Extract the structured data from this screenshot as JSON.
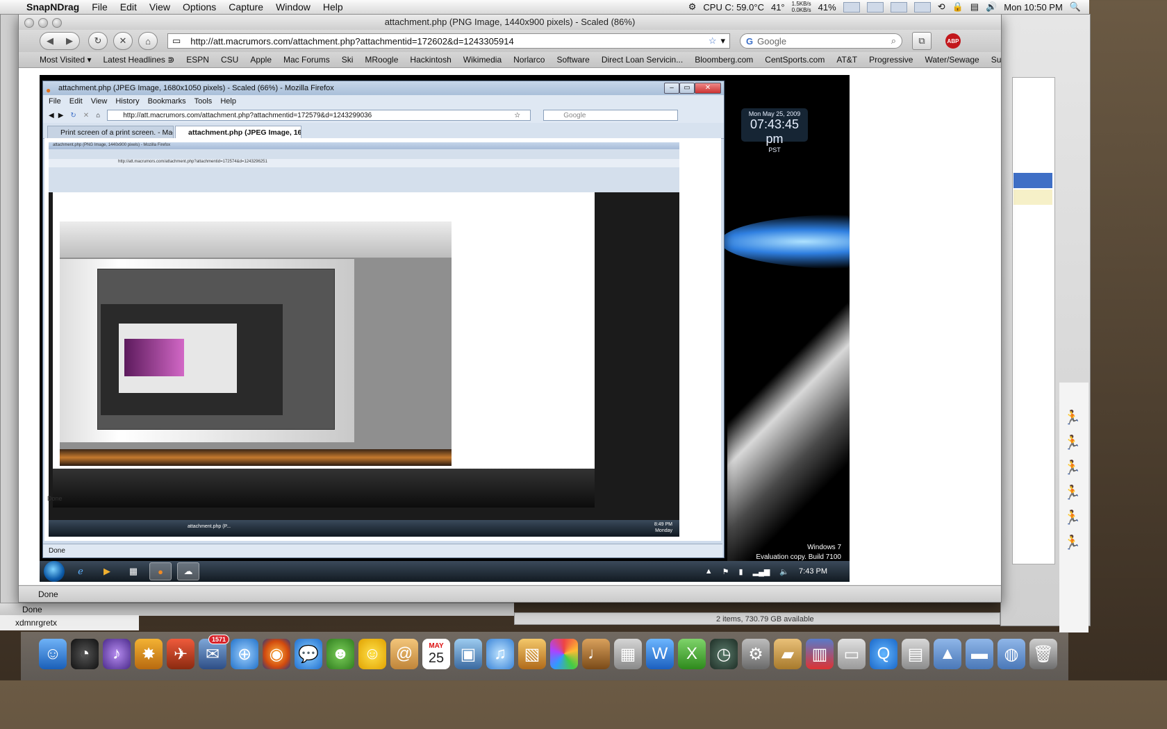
{
  "menubar": {
    "app": "SnapNDrag",
    "items": [
      "File",
      "Edit",
      "View",
      "Options",
      "Capture",
      "Window",
      "Help"
    ],
    "cpu": "CPU C: 59.0°C",
    "temp": "41°",
    "net_up": "1.5KB/s",
    "net_down": "0.0KB/s",
    "battery": "41%",
    "clock": "Mon 10:50 PM"
  },
  "outer_window": {
    "title": "attachment.php (PNG Image, 1440x900 pixels) - Scaled (86%)",
    "url": "http://att.macrumors.com/attachment.php?attachmentid=172602&d=1243305914",
    "search_placeholder": "Google",
    "abp_label": "ABP",
    "bookmarks": [
      "Most Visited ▾",
      "Latest Headlines ⋑",
      "ESPN",
      "CSU",
      "Apple",
      "Mac Forums",
      "Ski",
      "MRoogle",
      "Hackintosh",
      "Wikimedia",
      "Norlarco",
      "Software",
      "Direct Loan Servicin...",
      "Bloomberg.com",
      "CentSports.com",
      "AT&T",
      "Progressive",
      "Water/Sewage",
      "Sunmark"
    ],
    "status": "Done"
  },
  "win7": {
    "gadget_date": "Mon May 25, 2009",
    "gadget_time": "07:43:45 pm",
    "gadget_zone": "PST",
    "watermark1": "Windows 7",
    "watermark2": "Evaluation copy. Build 7100",
    "tray_time": "7:43 PM"
  },
  "inner_window": {
    "title": "attachment.php (JPEG Image, 1680x1050 pixels) - Scaled (66%) - Mozilla Firefox",
    "menu": [
      "File",
      "Edit",
      "View",
      "History",
      "Bookmarks",
      "Tools",
      "Help"
    ],
    "url": "http://att.macrumors.com/attachment.php?attachmentid=172579&d=1243299036",
    "search_placeholder": "Google",
    "tabs": [
      "Print screen of a print screen. - Mac...",
      "attachment.php (JPEG Image, 16..."
    ],
    "status": "Done"
  },
  "nested": {
    "title": "attachment.php (PNG Image, 1440x900 pixels) - Mozilla Firefox",
    "url": "http://att.macrumors.com/attachment.php?attachmentid=172574&d=1243296251",
    "status": "Done",
    "taskbar_item": "attachment.php (P...",
    "tray_time": "8:49 PM",
    "tray_day": "Monday"
  },
  "finder": {
    "status": "2 items, 730.79 GB available"
  },
  "left_status": {
    "done": "Done",
    "user": "xdmnrgretx"
  },
  "dock": {
    "mail_badge": "1571",
    "calendar_day": "25",
    "calendar_month": "MAY"
  }
}
